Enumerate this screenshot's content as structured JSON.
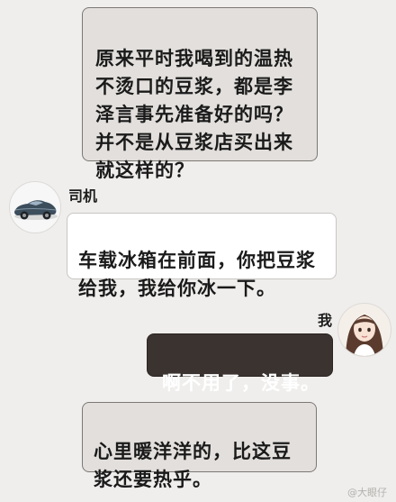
{
  "messages": [
    {
      "id": "msg-1",
      "text": "原来平时我喝到的温热\n不烫口的豆浆，都是李\n泽言事先准备好的吗？\n并不是从豆浆店买出来\n就这样的？"
    },
    {
      "id": "msg-2",
      "sender": "司机",
      "text": "车载冰箱在前面，你把豆浆\n给我，我给你冰一下。"
    },
    {
      "id": "msg-3",
      "sender": "我",
      "text": "啊不用了，没事。"
    },
    {
      "id": "msg-4",
      "text": "心里暖洋洋的，比这豆\n浆还要热乎。"
    }
  ],
  "senders": {
    "driver": "司机",
    "me": "我"
  },
  "watermark": "@大眼仔",
  "icons": {
    "driver_avatar": "car-avatar-icon",
    "me_avatar": "girl-avatar-icon"
  },
  "colors": {
    "background": "#efeeec",
    "narration_bubble": "#e2dfdc",
    "driver_bubble": "#ffffff",
    "me_bubble": "#3a3330"
  }
}
